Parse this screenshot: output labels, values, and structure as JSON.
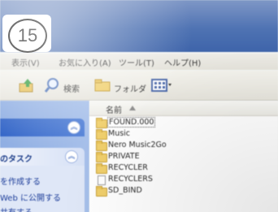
{
  "photo": {
    "badge_number": "15",
    "window": {
      "menu": [
        "表示(V)",
        "お気に入り(A)",
        "ツール(T)",
        "ヘルプ(H)"
      ],
      "toolbar": {
        "search_label": "検索",
        "folders_label": "フォルダ"
      },
      "task_pane": {
        "title": "のタスク",
        "links": [
          "を作成する",
          "Web に公開する",
          "共有する"
        ]
      },
      "file_list": {
        "column_header": "名前",
        "items": [
          {
            "name": "FOUND.000",
            "kind": "folder",
            "selected": true
          },
          {
            "name": "Music",
            "kind": "folder"
          },
          {
            "name": "Nero Music2Go",
            "kind": "folder"
          },
          {
            "name": "PRIVATE",
            "kind": "folder"
          },
          {
            "name": "RECYCLER",
            "kind": "folder"
          },
          {
            "name": "RECYCLERS",
            "kind": "file"
          },
          {
            "name": "SD_BIND",
            "kind": "folder"
          }
        ]
      }
    },
    "colors": {
      "titlebar": "#4f73b3",
      "taskpane": "#8faee3",
      "folder": "#f0cf6c"
    }
  }
}
